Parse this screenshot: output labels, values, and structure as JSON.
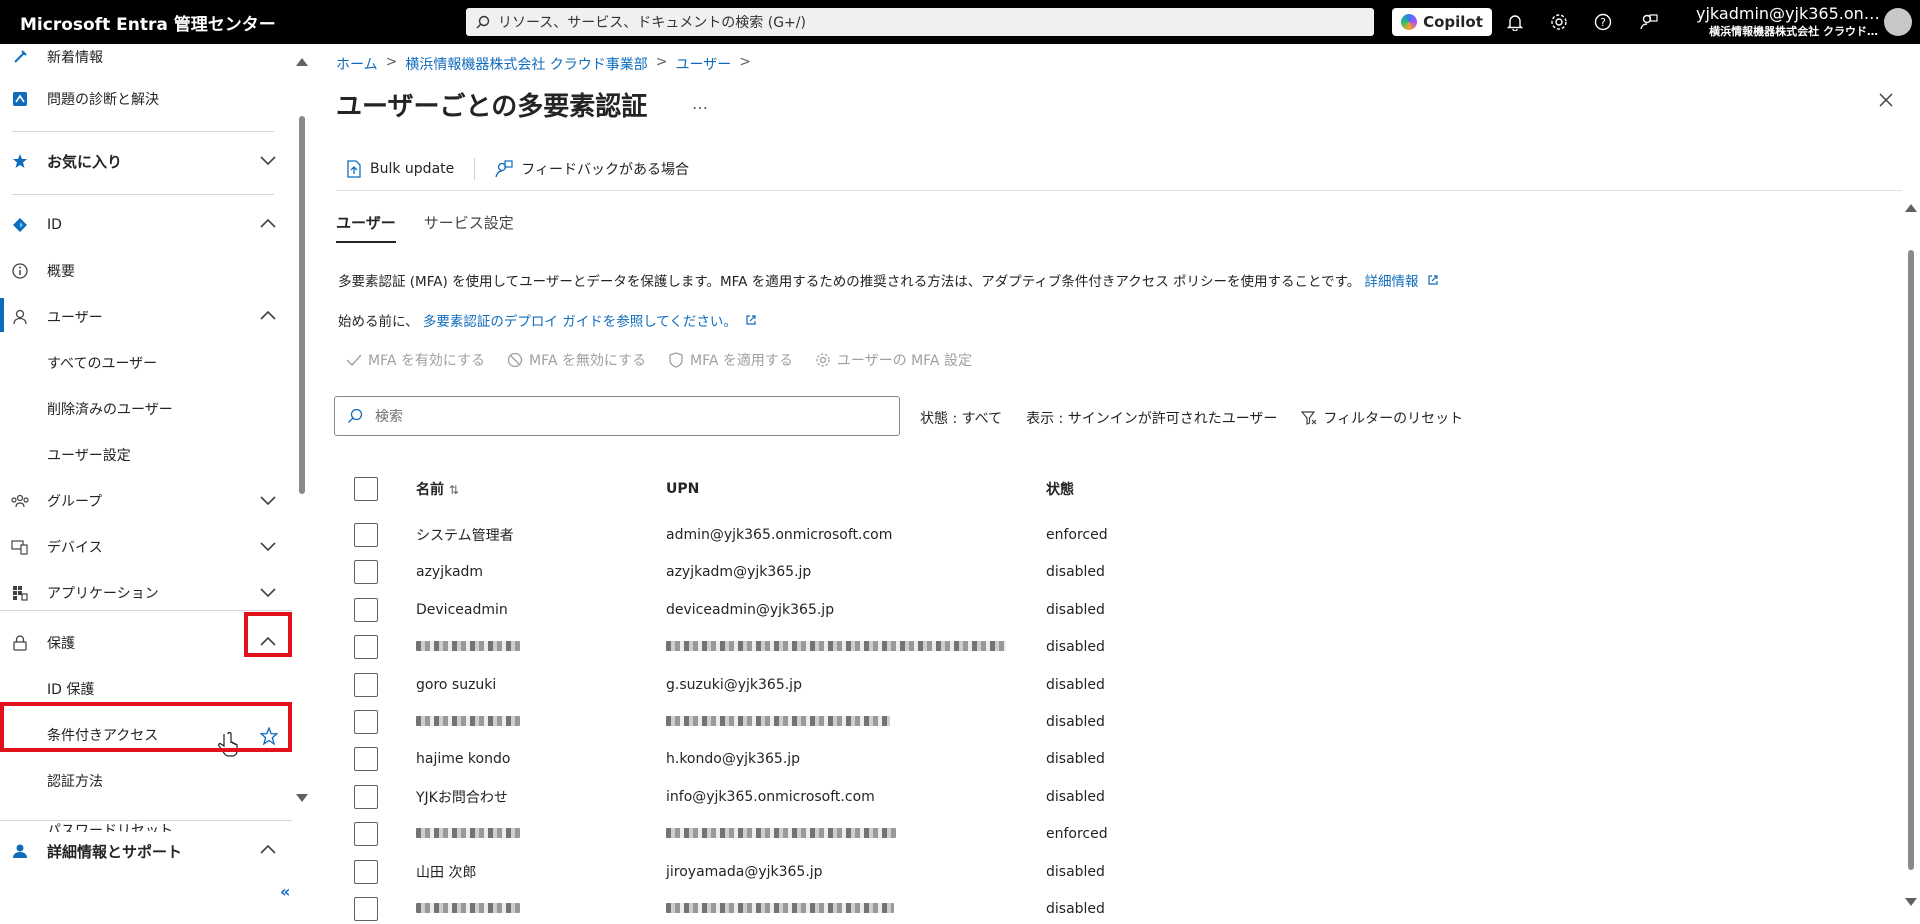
{
  "topbar": {
    "brand": "Microsoft Entra 管理センター",
    "search_placeholder": "リソース、サービス、ドキュメントの検索 (G+/)",
    "copilot_label": "Copilot",
    "account_user": "yjkadmin@yjk365.on…",
    "account_tenant": "横浜情報機器株式会社 クラウド…"
  },
  "sidebar": {
    "items": [
      {
        "label": "新着情報",
        "icon": "whats-new-icon"
      },
      {
        "label": "問題の診断と解決",
        "icon": "diagnose-icon"
      },
      {
        "label": "お気に入り",
        "icon": "star-icon"
      },
      {
        "label": "ID",
        "icon": "identity-icon"
      },
      {
        "label": "概要",
        "icon": "info-icon"
      },
      {
        "label": "ユーザー",
        "icon": "user-icon"
      },
      {
        "label": "すべてのユーザー"
      },
      {
        "label": "削除済みのユーザー"
      },
      {
        "label": "ユーザー設定"
      },
      {
        "label": "グループ",
        "icon": "groups-icon"
      },
      {
        "label": "デバイス",
        "icon": "devices-icon"
      },
      {
        "label": "アプリケーション",
        "icon": "apps-icon"
      },
      {
        "label": "保護",
        "icon": "lock-icon"
      },
      {
        "label": "ID 保護"
      },
      {
        "label": "条件付きアクセス"
      },
      {
        "label": "認証方法"
      },
      {
        "label": "パスワードリセット"
      },
      {
        "label": "詳細情報とサポート",
        "icon": "person-support-icon"
      }
    ],
    "collapse_label": "«"
  },
  "main": {
    "breadcrumb": [
      "ホーム",
      "横浜情報機器株式会社 クラウド事業部",
      "ユーザー"
    ],
    "title": "ユーザーごとの多要素認証",
    "more_label": "…",
    "commands": [
      "Bulk update",
      "フィードバックがある場合"
    ],
    "tabs": [
      "ユーザー",
      "サービス設定"
    ],
    "description": "多要素認証 (MFA) を使用してユーザーとデータを保護します。MFA を適用するための推奨される方法は、アダプティブ条件付きアクセス ポリシーを使用することです。",
    "description_link": "詳細情報",
    "before_text": "始める前に、",
    "before_link": "多要素認証のデプロイ ガイドを参照してください。",
    "actions": [
      "MFA を有効にする",
      "MFA を無効にする",
      "MFA を適用する",
      "ユーザーの MFA 設定"
    ],
    "search_placeholder": "検索",
    "filters": [
      "状態 : すべて",
      "表示 : サインインが許可されたユーザー",
      "フィルターのリセット"
    ],
    "table": {
      "headers": [
        "名前",
        "UPN",
        "状態"
      ],
      "rows": [
        {
          "name": "システム管理者",
          "upn": "admin@yjk365.onmicrosoft.com",
          "status": "enforced"
        },
        {
          "name": "azyjkadm",
          "upn": "azyjkadm@yjk365.jp",
          "status": "disabled"
        },
        {
          "name": "Deviceadmin",
          "upn": "deviceadmin@yjk365.jp",
          "status": "disabled"
        },
        {
          "name": "",
          "upn": "",
          "status": "disabled"
        },
        {
          "name": "goro suzuki",
          "upn": "g.suzuki@yjk365.jp",
          "status": "disabled"
        },
        {
          "name": "",
          "upn": "",
          "status": "disabled"
        },
        {
          "name": "hajime kondo",
          "upn": "h.kondo@yjk365.jp",
          "status": "disabled"
        },
        {
          "name": "YJKお問合わせ",
          "upn": "info@yjk365.onmicrosoft.com",
          "status": "disabled"
        },
        {
          "name": "",
          "upn": "",
          "status": "enforced"
        },
        {
          "name": "山田 次郎",
          "upn": "jiroyamada@yjk365.jp",
          "status": "disabled"
        },
        {
          "name": "",
          "upn": "",
          "status": "disabled"
        }
      ]
    }
  }
}
